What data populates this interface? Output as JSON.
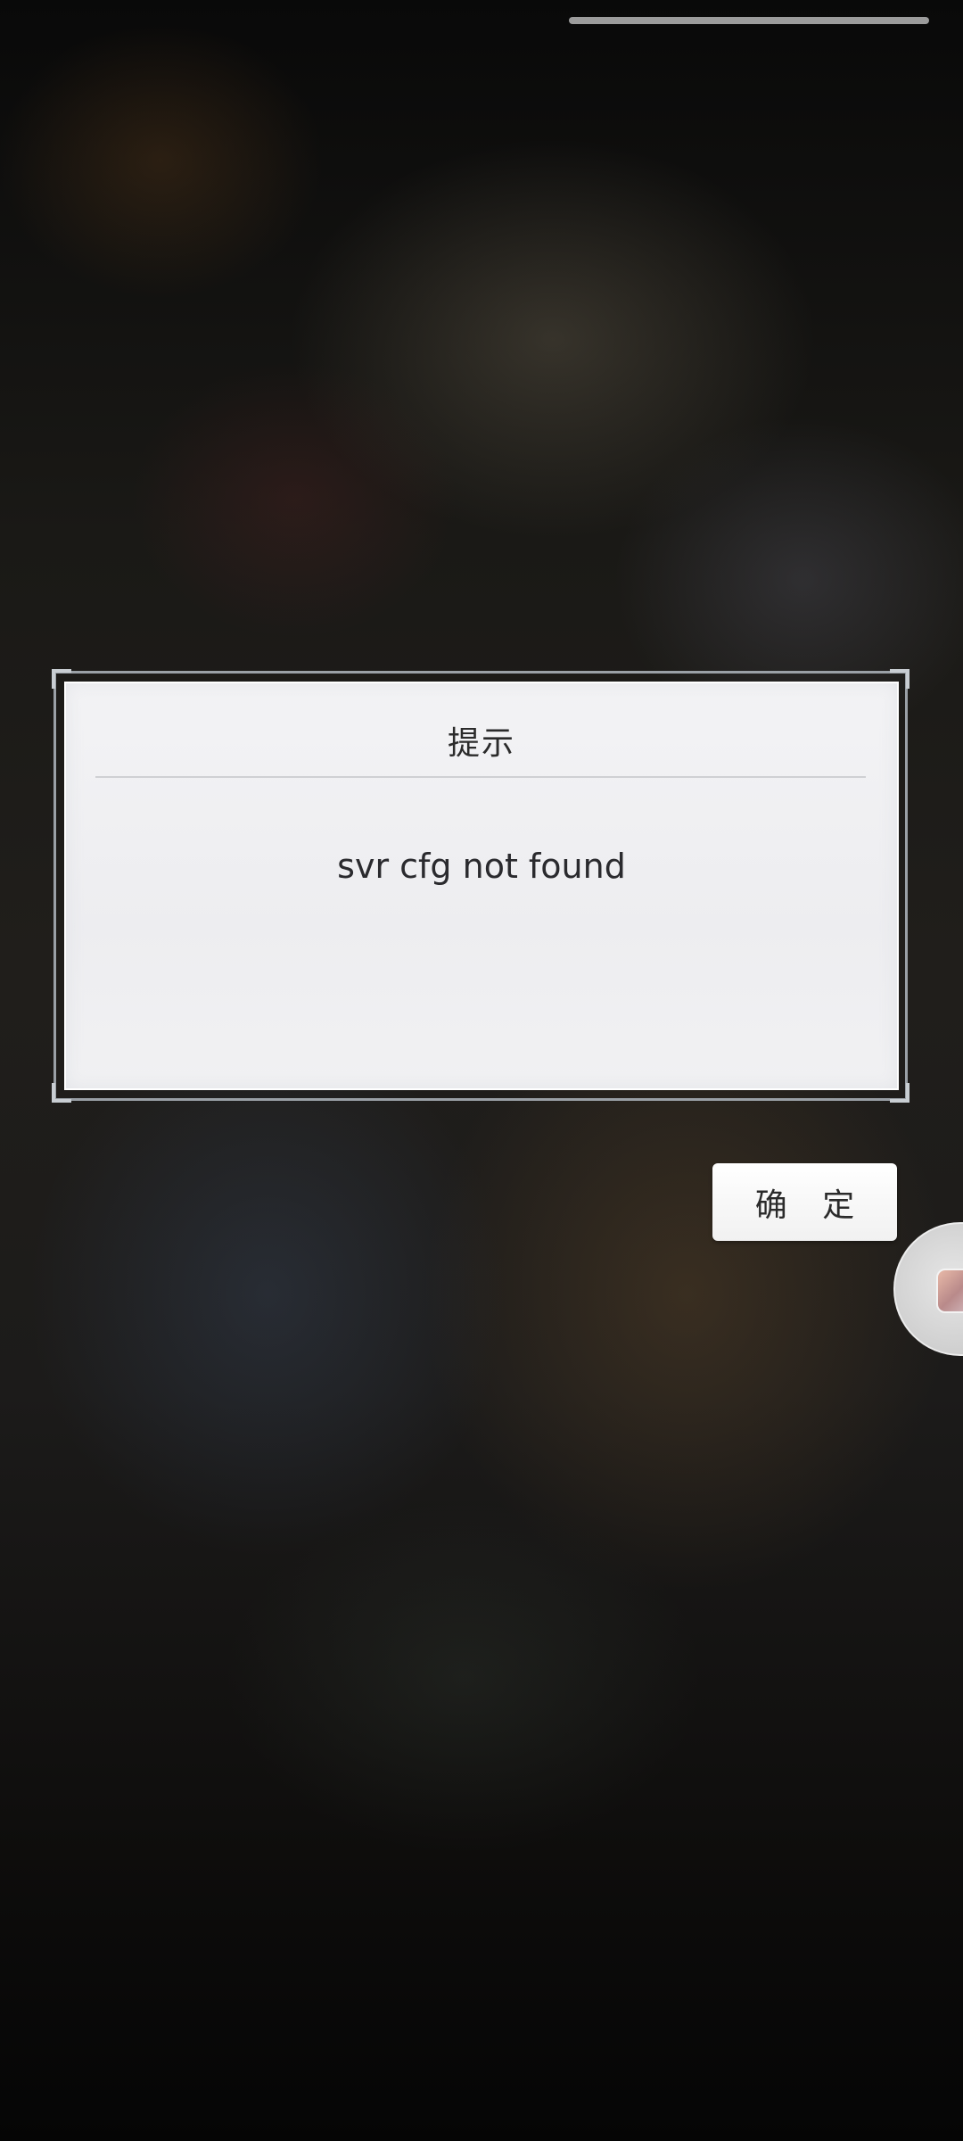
{
  "system": {
    "gesture_bar": "gesture-bar"
  },
  "dialog": {
    "title": "提示",
    "message": "svr cfg not found"
  },
  "actions": {
    "confirm_label": "确 定"
  },
  "floating_widget": {
    "icon": "app-avatar-icon"
  },
  "colors": {
    "dialog_background": "#efeff1",
    "frame_border": "#9aa0a6",
    "button_background": "#ffffff",
    "text": "#2b2b2b"
  }
}
